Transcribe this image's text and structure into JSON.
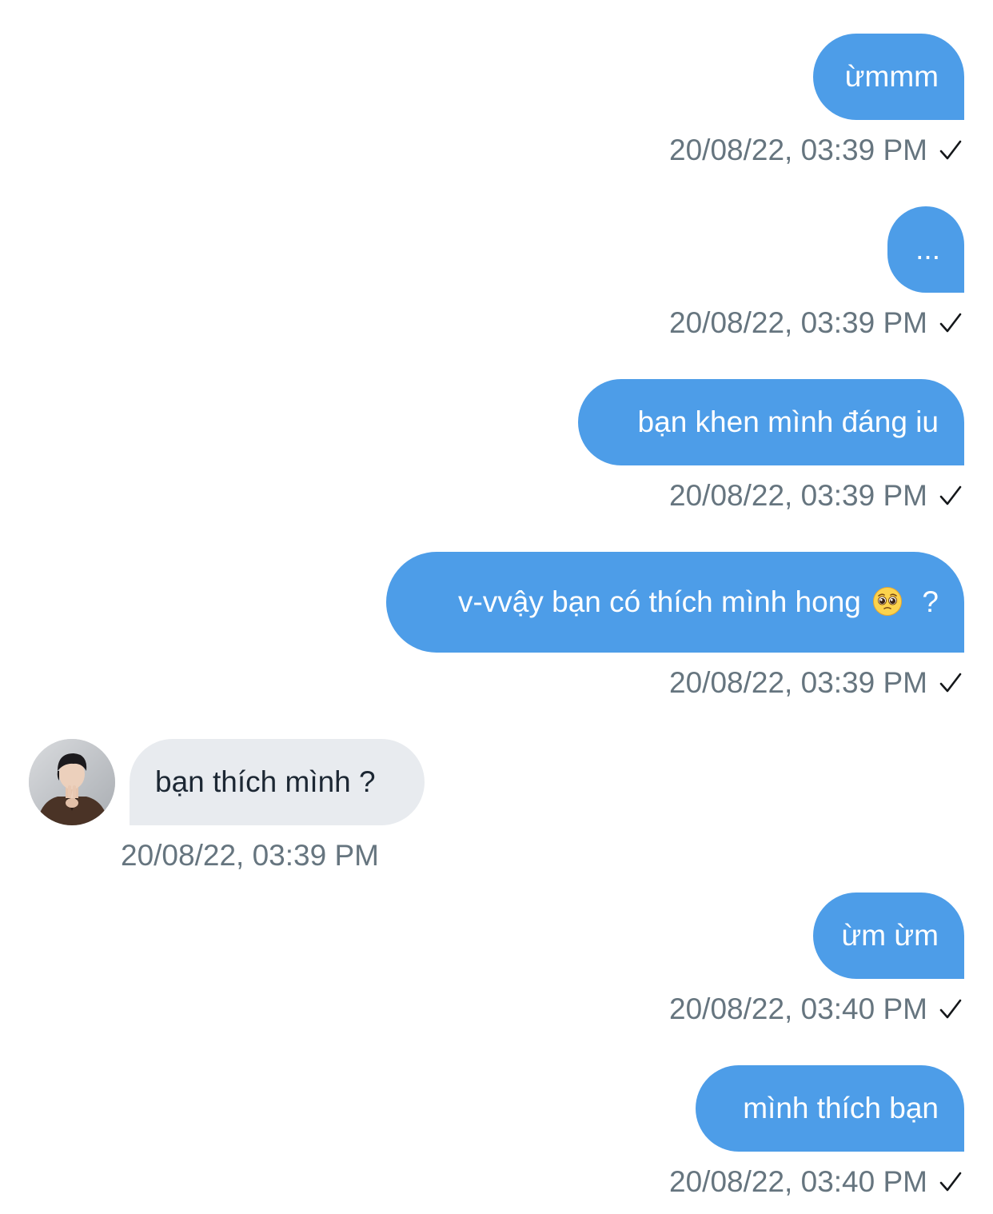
{
  "messages": [
    {
      "direction": "sent",
      "text": "ừmmm",
      "timestamp": "20/08/22, 03:39 PM",
      "status_icon": "check-icon"
    },
    {
      "direction": "sent",
      "text": "...",
      "timestamp": "20/08/22, 03:39 PM",
      "status_icon": "check-icon"
    },
    {
      "direction": "sent",
      "text": "bạn khen mình đáng iu",
      "timestamp": "20/08/22, 03:39 PM",
      "status_icon": "check-icon"
    },
    {
      "direction": "sent",
      "text_before_emoji": "v-vvậy bạn có thích mình hong",
      "emoji": "pleading-face-emoji",
      "text_after_emoji": "?",
      "timestamp": "20/08/22, 03:39 PM",
      "status_icon": "check-icon"
    },
    {
      "direction": "received",
      "text": "bạn thích mình ?",
      "timestamp": "20/08/22, 03:39 PM",
      "avatar": "avatar"
    },
    {
      "direction": "sent",
      "text": "ừm ừm",
      "timestamp": "20/08/22, 03:40 PM",
      "status_icon": "check-icon"
    },
    {
      "direction": "sent",
      "text": "mình thích bạn",
      "timestamp": "20/08/22, 03:40 PM",
      "status_icon": "check-icon"
    }
  ],
  "colors": {
    "sent_bubble": "#4d9de8",
    "sent_text": "#ffffff",
    "received_bubble": "#e8ebef",
    "received_text": "#1c2733",
    "timestamp": "#66757f",
    "background": "#ffffff"
  }
}
